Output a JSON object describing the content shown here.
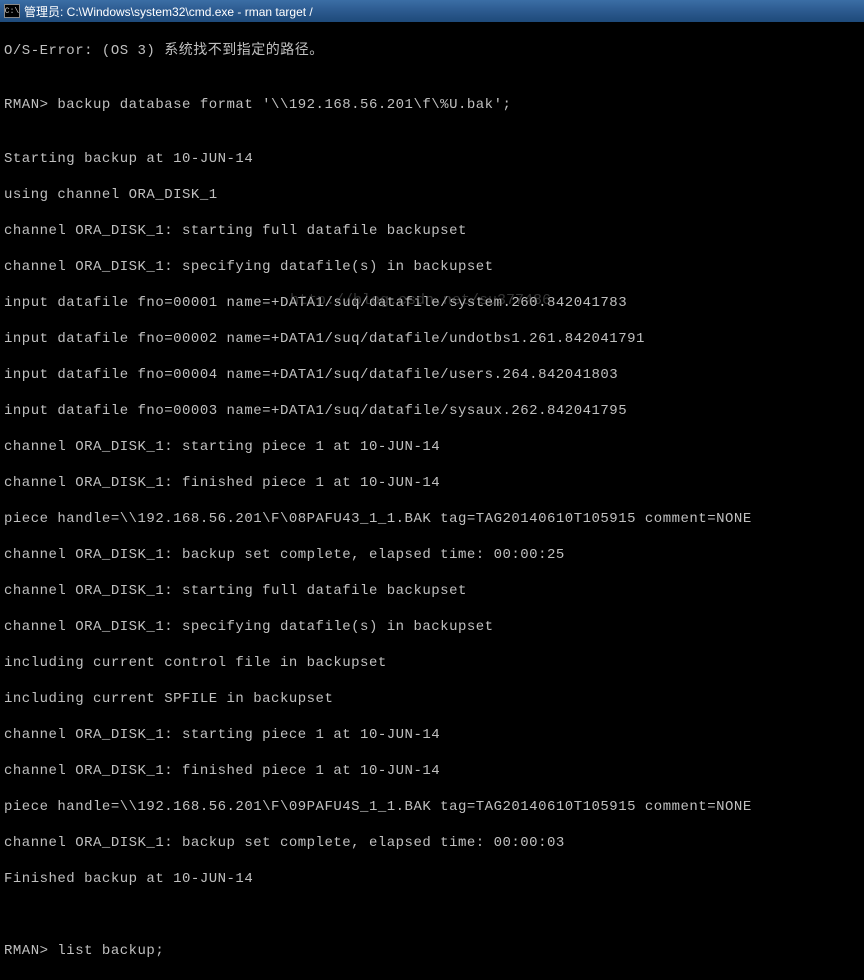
{
  "titlebar": {
    "icon_text": "C:\\",
    "title": "管理员: C:\\Windows\\system32\\cmd.exe - rman  target /"
  },
  "terminal": {
    "lines": [
      "O/S-Error: (OS 3) 系统找不到指定的路径。",
      "",
      "RMAN> backup database format '\\\\192.168.56.201\\f\\%U.bak';",
      "",
      "Starting backup at 10-JUN-14",
      "using channel ORA_DISK_1",
      "channel ORA_DISK_1: starting full datafile backupset",
      "channel ORA_DISK_1: specifying datafile(s) in backupset",
      "input datafile fno=00001 name=+DATA1/suq/datafile/system.260.842041783",
      "input datafile fno=00002 name=+DATA1/suq/datafile/undotbs1.261.842041791",
      "input datafile fno=00004 name=+DATA1/suq/datafile/users.264.842041803",
      "input datafile fno=00003 name=+DATA1/suq/datafile/sysaux.262.842041795",
      "channel ORA_DISK_1: starting piece 1 at 10-JUN-14",
      "channel ORA_DISK_1: finished piece 1 at 10-JUN-14",
      "piece handle=\\\\192.168.56.201\\F\\08PAFU43_1_1.BAK tag=TAG20140610T105915 comment=NONE",
      "channel ORA_DISK_1: backup set complete, elapsed time: 00:00:25",
      "channel ORA_DISK_1: starting full datafile backupset",
      "channel ORA_DISK_1: specifying datafile(s) in backupset",
      "including current control file in backupset",
      "including current SPFILE in backupset",
      "channel ORA_DISK_1: starting piece 1 at 10-JUN-14",
      "channel ORA_DISK_1: finished piece 1 at 10-JUN-14",
      "piece handle=\\\\192.168.56.201\\F\\09PAFU4S_1_1.BAK tag=TAG20140610T105915 comment=NONE",
      "channel ORA_DISK_1: backup set complete, elapsed time: 00:00:03",
      "Finished backup at 10-JUN-14",
      "",
      "",
      "RMAN> list backup;"
    ]
  },
  "watermark": "http://blog.csdn.net/su377486"
}
